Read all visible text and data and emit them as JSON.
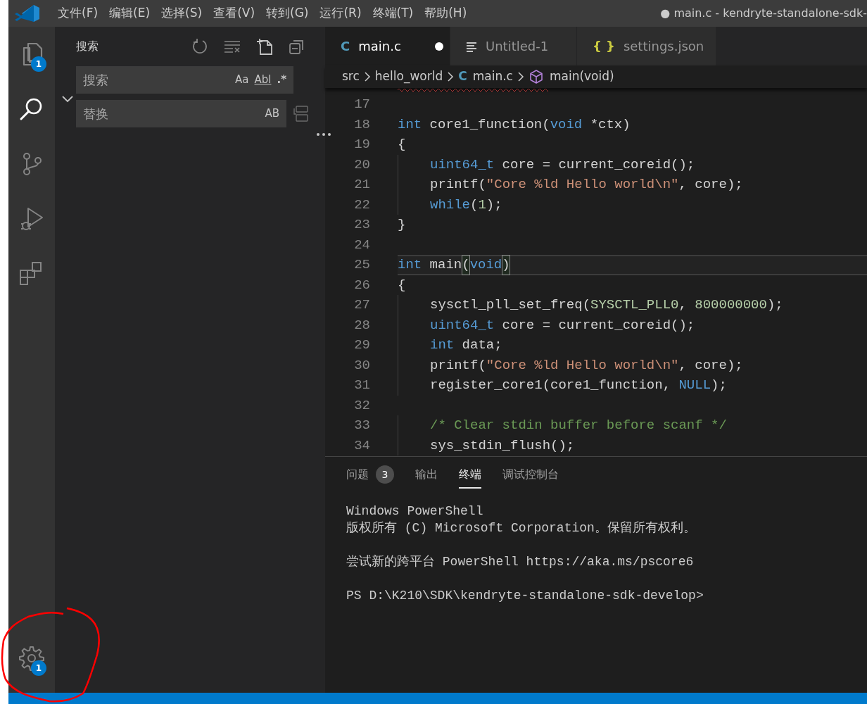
{
  "window": {
    "title": "● main.c - kendryte-standalone-sdk-"
  },
  "menu": [
    "文件(F)",
    "编辑(E)",
    "选择(S)",
    "查看(V)",
    "转到(G)",
    "运行(R)",
    "终端(T)",
    "帮助(H)"
  ],
  "activity_bar": [
    {
      "kind": "explorer",
      "badge": "1",
      "selected": false
    },
    {
      "kind": "search",
      "selected": true
    },
    {
      "kind": "source-control",
      "selected": false
    },
    {
      "kind": "run-debug",
      "selected": false
    },
    {
      "kind": "extensions",
      "selected": false
    }
  ],
  "manage": {
    "badge": "1"
  },
  "sidebar": {
    "title": "搜索",
    "replace_expanded": true,
    "search": {
      "placeholder": "搜索",
      "options": [
        "Aa",
        "Abl",
        ".*"
      ]
    },
    "replace": {
      "placeholder": "替换",
      "options": [
        "AB"
      ]
    }
  },
  "tabs": [
    {
      "kind": "c",
      "icon": "C",
      "label": "main.c",
      "selected": true,
      "dirty": true
    },
    {
      "kind": "plain",
      "label": "Untitled-1",
      "selected": false,
      "dirty": false
    },
    {
      "kind": "json",
      "icon": "{ }",
      "label": "settings.json",
      "selected": false,
      "dirty": false
    }
  ],
  "breadcrumbs": [
    {
      "kind": "folder",
      "label": "src"
    },
    {
      "kind": "folder",
      "label": "hello_world"
    },
    {
      "kind": "c",
      "icon": "C",
      "label": "main.c"
    },
    {
      "kind": "symbol",
      "label": "main(void)"
    }
  ],
  "code": [
    {
      "number": "17",
      "indented": false,
      "current": false
    },
    {
      "number": "18",
      "indented": false,
      "current": false,
      "tokens": [
        {
          "kind": "keyword",
          "text": "int"
        },
        {
          "kind": "plain",
          "text": " core1_function("
        },
        {
          "kind": "keyword",
          "text": "void"
        },
        {
          "kind": "plain",
          "text": " *ctx)"
        }
      ]
    },
    {
      "number": "19",
      "indented": false,
      "current": false,
      "tokens": [
        {
          "kind": "plain",
          "text": "{"
        }
      ]
    },
    {
      "number": "20",
      "indented": true,
      "current": false,
      "tokens": [
        {
          "kind": "keyword",
          "text": "uint64_t"
        },
        {
          "kind": "plain",
          "text": " core = current_coreid();"
        }
      ]
    },
    {
      "number": "21",
      "indented": true,
      "current": false,
      "tokens": [
        {
          "kind": "plain",
          "text": "printf("
        },
        {
          "kind": "string",
          "text": "\"Core %ld Hello world\\n\""
        },
        {
          "kind": "plain",
          "text": ", core);"
        }
      ]
    },
    {
      "number": "22",
      "indented": true,
      "current": false,
      "tokens": [
        {
          "kind": "keyword",
          "text": "while"
        },
        {
          "kind": "plain",
          "text": "("
        },
        {
          "kind": "number",
          "text": "1"
        },
        {
          "kind": "plain",
          "text": ");"
        }
      ]
    },
    {
      "number": "23",
      "indented": false,
      "current": false,
      "tokens": [
        {
          "kind": "plain",
          "text": "}"
        }
      ]
    },
    {
      "number": "24",
      "indented": false,
      "current": false
    },
    {
      "number": "25",
      "indented": false,
      "current": true,
      "tokens": [
        {
          "kind": "keyword",
          "text": "int"
        },
        {
          "kind": "plain",
          "text": " main"
        },
        {
          "kind": "bracket",
          "text": "("
        },
        {
          "kind": "keyword",
          "text": "void"
        },
        {
          "kind": "bracket",
          "text": ")"
        }
      ]
    },
    {
      "number": "26",
      "indented": false,
      "current": false,
      "tokens": [
        {
          "kind": "plain",
          "text": "{"
        }
      ]
    },
    {
      "number": "27",
      "indented": true,
      "current": false,
      "tokens": [
        {
          "kind": "plain",
          "text": "sysctl_pll_set_freq("
        },
        {
          "kind": "constant",
          "text": "SYSCTL_PLL0"
        },
        {
          "kind": "plain",
          "text": ", "
        },
        {
          "kind": "number",
          "text": "800000000"
        },
        {
          "kind": "plain",
          "text": ");"
        }
      ]
    },
    {
      "number": "28",
      "indented": true,
      "current": false,
      "tokens": [
        {
          "kind": "keyword",
          "text": "uint64_t"
        },
        {
          "kind": "plain",
          "text": " core = current_coreid();"
        }
      ]
    },
    {
      "number": "29",
      "indented": true,
      "current": false,
      "tokens": [
        {
          "kind": "keyword",
          "text": "int"
        },
        {
          "kind": "plain",
          "text": " data;"
        }
      ]
    },
    {
      "number": "30",
      "indented": true,
      "current": false,
      "tokens": [
        {
          "kind": "plain",
          "text": "printf("
        },
        {
          "kind": "string",
          "text": "\"Core %ld Hello world\\n\""
        },
        {
          "kind": "plain",
          "text": ", core);"
        }
      ]
    },
    {
      "number": "31",
      "indented": true,
      "current": false,
      "tokens": [
        {
          "kind": "plain",
          "text": "register_core1(core1_function, "
        },
        {
          "kind": "keyword",
          "text": "NULL"
        },
        {
          "kind": "plain",
          "text": ");"
        }
      ]
    },
    {
      "number": "32",
      "indented": false,
      "current": false
    },
    {
      "number": "33",
      "indented": true,
      "current": false,
      "tokens": [
        {
          "kind": "comment",
          "text": "/* Clear stdin buffer before scanf */"
        }
      ]
    },
    {
      "number": "34",
      "indented": true,
      "current": false,
      "tokens": [
        {
          "kind": "plain",
          "text": "sys_stdin_flush();"
        }
      ]
    }
  ],
  "panel_tabs": [
    {
      "label": "问题",
      "badge": "3",
      "selected": false
    },
    {
      "label": "输出",
      "selected": false
    },
    {
      "label": "终端",
      "selected": true
    },
    {
      "label": "调试控制台",
      "selected": false
    }
  ],
  "terminal": [
    {
      "text": "Windows PowerShell",
      "blank_before": false
    },
    {
      "text": "版权所有 (C) Microsoft Corporation。保留所有权利。",
      "blank_before": false
    },
    {
      "text": "尝试新的跨平台 PowerShell https://aka.ms/pscore6",
      "blank_before": true
    },
    {
      "text": "PS D:\\K210\\SDK\\kendryte-standalone-sdk-develop>",
      "blank_before": true
    }
  ]
}
